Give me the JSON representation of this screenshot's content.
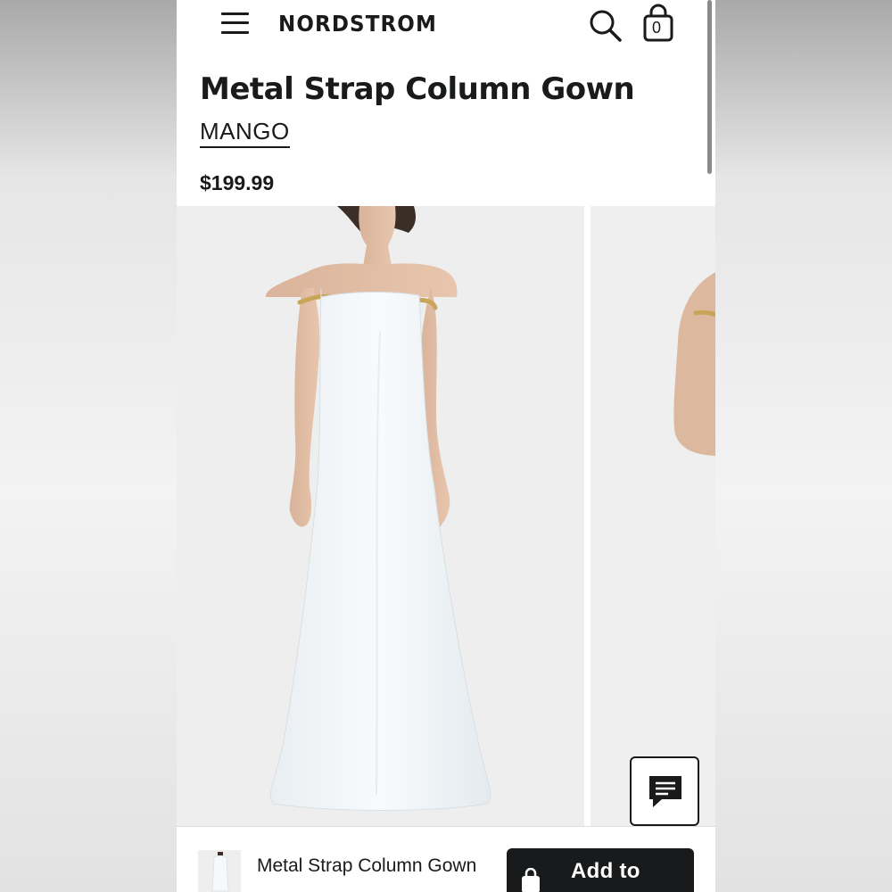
{
  "header": {
    "brand": "NORDSTROM",
    "bag_count": "0",
    "icons": [
      "menu-icon",
      "search-icon",
      "shopping-bag-icon"
    ]
  },
  "product": {
    "title": "Metal Strap Column Gown",
    "brand": "MANGO",
    "price": "$199.99"
  },
  "gallery": {
    "images": [
      "product-photo-front",
      "product-photo-side"
    ]
  },
  "chat": {
    "icon": "chat-icon"
  },
  "bottom_bar": {
    "product_name": "Metal Strap Column Gown",
    "add_label": "Add to"
  },
  "colors": {
    "text": "#191a1b",
    "button": "#191a1b",
    "photo_bg": "#eeeeee"
  }
}
